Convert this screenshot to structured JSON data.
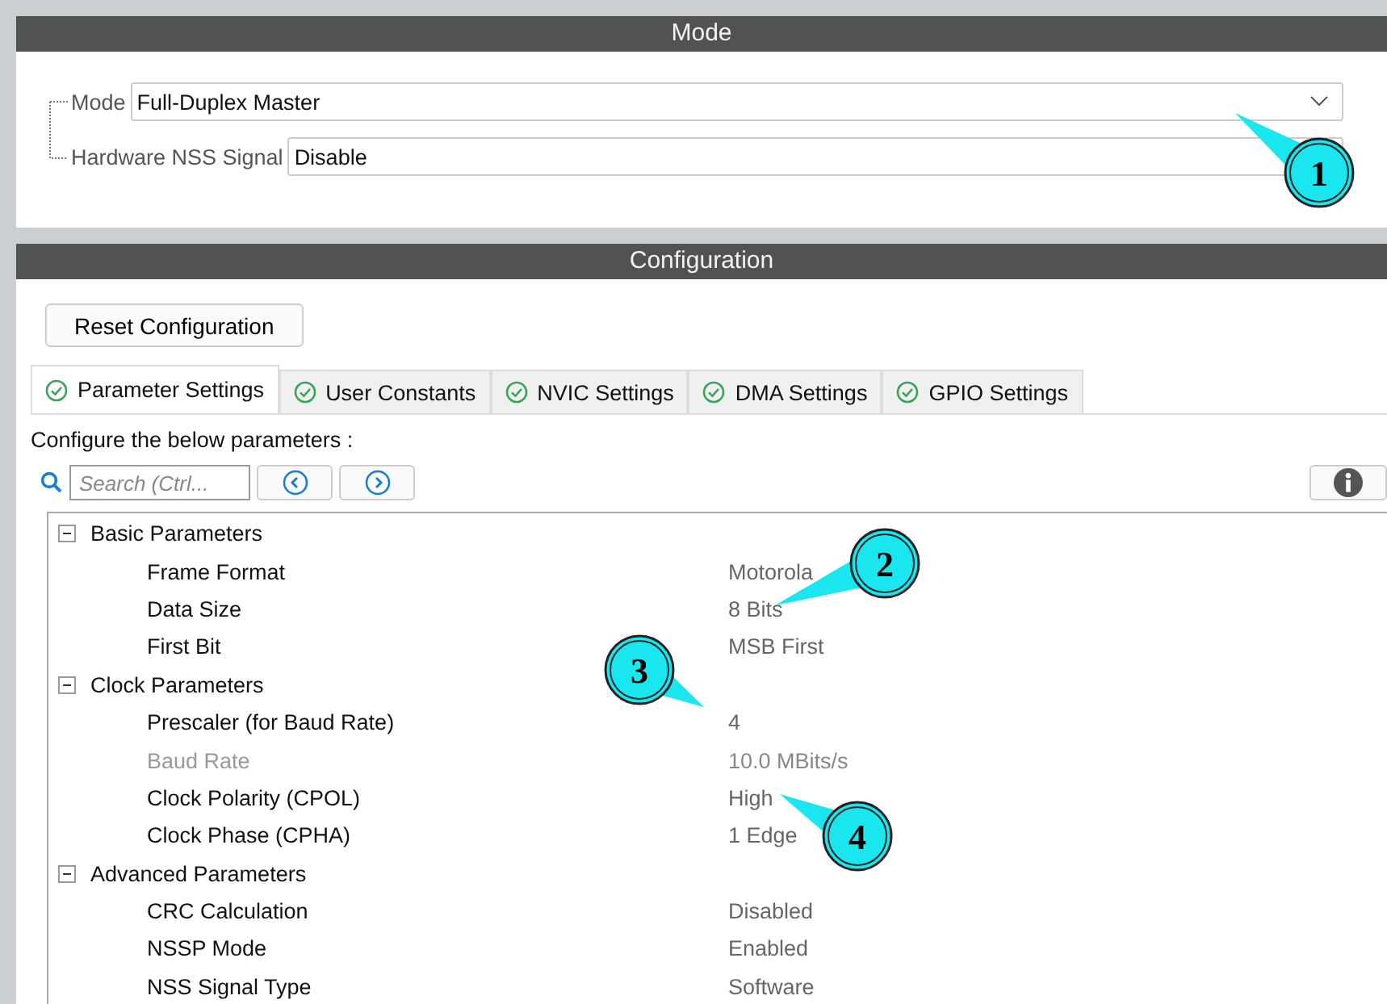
{
  "mode_section": {
    "title": "Mode",
    "fields": [
      {
        "label": "Mode",
        "value": "Full-Duplex Master",
        "kind": "dropdown"
      },
      {
        "label": "Hardware NSS Signal",
        "value": "Disable",
        "kind": "text"
      }
    ]
  },
  "configuration": {
    "title": "Configuration",
    "reset_button": "Reset Configuration",
    "tabs": [
      {
        "label": "Parameter Settings",
        "selected": true
      },
      {
        "label": "User Constants",
        "selected": false
      },
      {
        "label": "NVIC Settings",
        "selected": false
      },
      {
        "label": "DMA Settings",
        "selected": false
      },
      {
        "label": "GPIO Settings",
        "selected": false
      }
    ],
    "hint": "Configure the below parameters :",
    "search": {
      "placeholder": "Search (Ctrl..."
    },
    "parameters": [
      {
        "label": "Basic Parameters",
        "expanded": true,
        "children": [
          {
            "label": "Frame Format",
            "value": "Motorola",
            "disabled": false
          },
          {
            "label": "Data Size",
            "value": "8 Bits",
            "disabled": false
          },
          {
            "label": "First Bit",
            "value": "MSB First",
            "disabled": false
          }
        ]
      },
      {
        "label": "Clock Parameters",
        "expanded": true,
        "children": [
          {
            "label": "Prescaler (for Baud Rate)",
            "value": "4",
            "disabled": false
          },
          {
            "label": "Baud Rate",
            "value": "10.0 MBits/s",
            "disabled": true
          },
          {
            "label": "Clock Polarity (CPOL)",
            "value": "High",
            "disabled": false
          },
          {
            "label": "Clock Phase (CPHA)",
            "value": "1 Edge",
            "disabled": false
          }
        ]
      },
      {
        "label": "Advanced Parameters",
        "expanded": true,
        "children": [
          {
            "label": "CRC Calculation",
            "value": "Disabled",
            "disabled": false
          },
          {
            "label": "NSSP Mode",
            "value": "Enabled",
            "disabled": false
          },
          {
            "label": "NSS Signal Type",
            "value": "Software",
            "disabled": false
          }
        ]
      }
    ]
  },
  "callouts": [
    {
      "label": "1"
    },
    {
      "label": "2"
    },
    {
      "label": "3"
    },
    {
      "label": "4"
    }
  ]
}
